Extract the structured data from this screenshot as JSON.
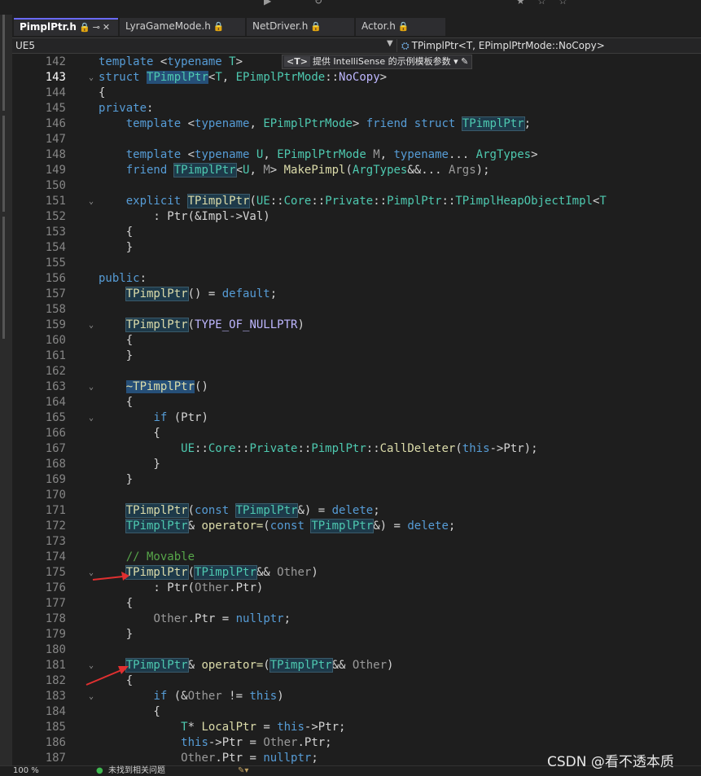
{
  "tabs": [
    {
      "label": "PimplPtr.h",
      "active": true
    },
    {
      "label": "LyraGameMode.h",
      "active": false
    },
    {
      "label": "NetDriver.h",
      "active": false
    },
    {
      "label": "Actor.h",
      "active": false
    }
  ],
  "navbar": {
    "scope": "UE5",
    "member": "TPimplPtr<T, EPimplPtrMode::NoCopy>"
  },
  "intellisense_hint": {
    "badge": "<T>",
    "text": "提供 IntelliSense 的示例模板参数"
  },
  "code_lines": [
    {
      "n": "142",
      "h": "<span class=\"kw\">template</span> &lt;<span class=\"kw\">typename</span> <span class=\"ty\">T</span>&gt;"
    },
    {
      "n": "143",
      "h": "<span class=\"kw\">struct</span> <span class=\"ty hls\">TPimplPtr</span>&lt;<span class=\"ty\">T</span>, <span class=\"ty\">EPimplPtrMode</span>::<span class=\"mac\">NoCopy</span>&gt;"
    },
    {
      "n": "144",
      "h": "{"
    },
    {
      "n": "145",
      "h": "<span class=\"kw\">private</span>:"
    },
    {
      "n": "146",
      "h": "    <span class=\"kw\">template</span> &lt;<span class=\"kw\">typename</span>, <span class=\"ty\">EPimplPtrMode</span>&gt; <span class=\"kw\">friend</span> <span class=\"kw\">struct</span> <span class=\"ty hl\">TPimplPtr</span>;"
    },
    {
      "n": "147",
      "h": ""
    },
    {
      "n": "148",
      "h": "    <span class=\"kw\">template</span> &lt;<span class=\"kw\">typename</span> <span class=\"ty\">U</span>, <span class=\"ty\">EPimplPtrMode</span> <span class=\"pm\">M</span>, <span class=\"kw\">typename</span>... <span class=\"ty\">ArgTypes</span>&gt;"
    },
    {
      "n": "149",
      "h": "    <span class=\"kw\">friend</span> <span class=\"ty hl\">TPimplPtr</span>&lt;<span class=\"ty\">U</span>, <span class=\"pm\">M</span>&gt; <span class=\"fn\">MakePimpl</span>(<span class=\"ty\">ArgTypes</span>&amp;&amp;... <span class=\"pm\">Args</span>);"
    },
    {
      "n": "150",
      "h": ""
    },
    {
      "n": "151",
      "h": "    <span class=\"kw\">explicit</span> <span class=\"fn hl\">TPimplPtr</span>(<span class=\"ty\">UE</span>::<span class=\"ty\">Core</span>::<span class=\"ty\">Private</span>::<span class=\"ty\">PimplPtr</span>::<span class=\"ty\">TPimplHeapObjectImpl</span>&lt;<span class=\"ty\">T</span>"
    },
    {
      "n": "152",
      "h": "        : Ptr(&amp;Impl-&gt;Val)"
    },
    {
      "n": "153",
      "h": "    {"
    },
    {
      "n": "154",
      "h": "    }"
    },
    {
      "n": "155",
      "h": ""
    },
    {
      "n": "156",
      "h": "<span class=\"kw\">public</span>:"
    },
    {
      "n": "157",
      "h": "    <span class=\"fn hl\">TPimplPtr</span>() = <span class=\"kw\">default</span>;"
    },
    {
      "n": "158",
      "h": ""
    },
    {
      "n": "159",
      "h": "    <span class=\"fn hl\">TPimplPtr</span>(<span class=\"mac\">TYPE_OF_NULLPTR</span>)"
    },
    {
      "n": "160",
      "h": "    {"
    },
    {
      "n": "161",
      "h": "    }"
    },
    {
      "n": "162",
      "h": ""
    },
    {
      "n": "163",
      "h": "    <span class=\"fn hls\">~TPimplPtr</span>()"
    },
    {
      "n": "164",
      "h": "    {"
    },
    {
      "n": "165",
      "h": "        <span class=\"kw\">if</span> (Ptr)"
    },
    {
      "n": "166",
      "h": "        {"
    },
    {
      "n": "167",
      "h": "            <span class=\"ty\">UE</span>::<span class=\"ty\">Core</span>::<span class=\"ty\">Private</span>::<span class=\"ty\">PimplPtr</span>::<span class=\"fn\">CallDeleter</span>(<span class=\"kw\">this</span>-&gt;Ptr);"
    },
    {
      "n": "168",
      "h": "        }"
    },
    {
      "n": "169",
      "h": "    }"
    },
    {
      "n": "170",
      "h": ""
    },
    {
      "n": "171",
      "h": "    <span class=\"fn hl\">TPimplPtr</span>(<span class=\"kw\">const</span> <span class=\"ty hl\">TPimplPtr</span>&amp;) = <span class=\"kw\">delete</span>;"
    },
    {
      "n": "172",
      "h": "    <span class=\"ty hl\">TPimplPtr</span>&amp; <span class=\"fn\">operator=</span>(<span class=\"kw\">const</span> <span class=\"ty hl\">TPimplPtr</span>&amp;) = <span class=\"kw\">delete</span>;"
    },
    {
      "n": "173",
      "h": ""
    },
    {
      "n": "174",
      "h": "    <span class=\"cm\">// Movable</span>"
    },
    {
      "n": "175",
      "h": "    <span class=\"fn hl\">TPimplPtr</span>(<span class=\"ty hl\">TPimplPtr</span>&amp;&amp; <span class=\"pm\">Other</span>)"
    },
    {
      "n": "176",
      "h": "        : Ptr(<span class=\"pm\">Other</span>.Ptr)"
    },
    {
      "n": "177",
      "h": "    {"
    },
    {
      "n": "178",
      "h": "        <span class=\"pm\">Other</span>.Ptr = <span class=\"kw\">nullptr</span>;"
    },
    {
      "n": "179",
      "h": "    }"
    },
    {
      "n": "180",
      "h": ""
    },
    {
      "n": "181",
      "h": "    <span class=\"ty hl\">TPimplPtr</span>&amp; <span class=\"fn\">operator=</span>(<span class=\"ty hl\">TPimplPtr</span>&amp;&amp; <span class=\"pm\">Other</span>)"
    },
    {
      "n": "182",
      "h": "    {"
    },
    {
      "n": "183",
      "h": "        <span class=\"kw\">if</span> (&amp;<span class=\"pm\">Other</span> != <span class=\"kw\">this</span>)"
    },
    {
      "n": "184",
      "h": "        {"
    },
    {
      "n": "185",
      "h": "            <span class=\"ty\">T</span>* <span class=\"fn\">LocalPtr</span> = <span class=\"kw\">this</span>-&gt;Ptr;"
    },
    {
      "n": "186",
      "h": "            <span class=\"kw\">this</span>-&gt;Ptr = <span class=\"pm\">Other</span>.Ptr;"
    },
    {
      "n": "187",
      "h": "            <span class=\"pm\">Other</span>.Ptr = <span class=\"kw\">nullptr</span>;"
    }
  ],
  "folds": [
    "143",
    "151",
    "159",
    "163",
    "165",
    "175",
    "181",
    "183"
  ],
  "statusbar": {
    "zoom": "100 %",
    "message": "未找到相关问题"
  },
  "watermark": "CSDN @看不透本质",
  "colors": {
    "keyword": "#569cd6",
    "type": "#4ec9b0",
    "function": "#dcdcaa",
    "comment": "#57a64a",
    "annotation_arrow": "#e03030"
  }
}
